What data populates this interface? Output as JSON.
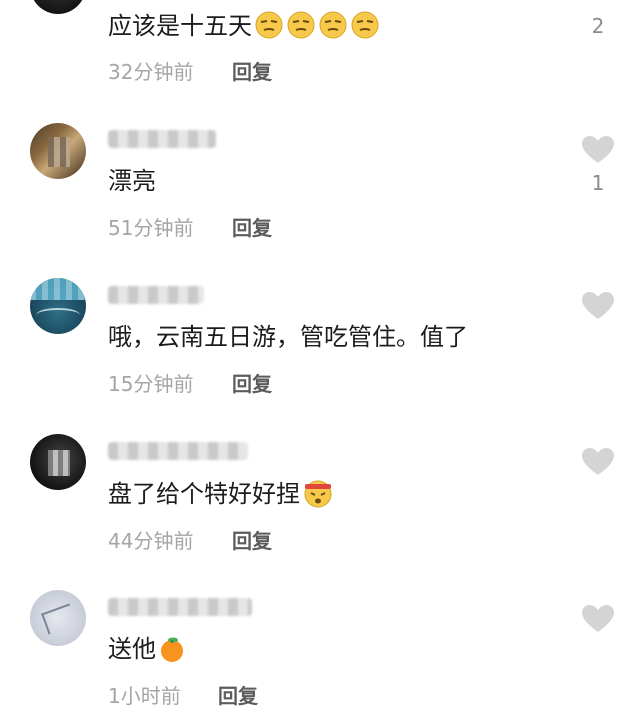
{
  "comments": [
    {
      "text": "应该是十五天",
      "emojis": [
        "smirk-face-icon",
        "smirk-face-icon",
        "smirk-face-icon",
        "smirk-face-icon"
      ],
      "time": "32分钟前",
      "reply": "回复",
      "likes": "2"
    },
    {
      "text": "漂亮",
      "time": "51分钟前",
      "reply": "回复",
      "likes": "1"
    },
    {
      "text": "哦，云南五日游，管吃管住。值了",
      "time": "15分钟前",
      "reply": "回复",
      "likes": ""
    },
    {
      "text": "盘了给个特好好捏",
      "emojis": [
        "angry-headband-face-icon"
      ],
      "time": "44分钟前",
      "reply": "回复",
      "likes": ""
    },
    {
      "text": "送他",
      "emojis": [
        "tangerine-icon"
      ],
      "time": "1小时前",
      "reply": "回复",
      "likes": ""
    }
  ],
  "colors": {
    "heart": "#d4d4d4",
    "meta": "#a5a5a5",
    "reply": "#5c5c5c"
  }
}
